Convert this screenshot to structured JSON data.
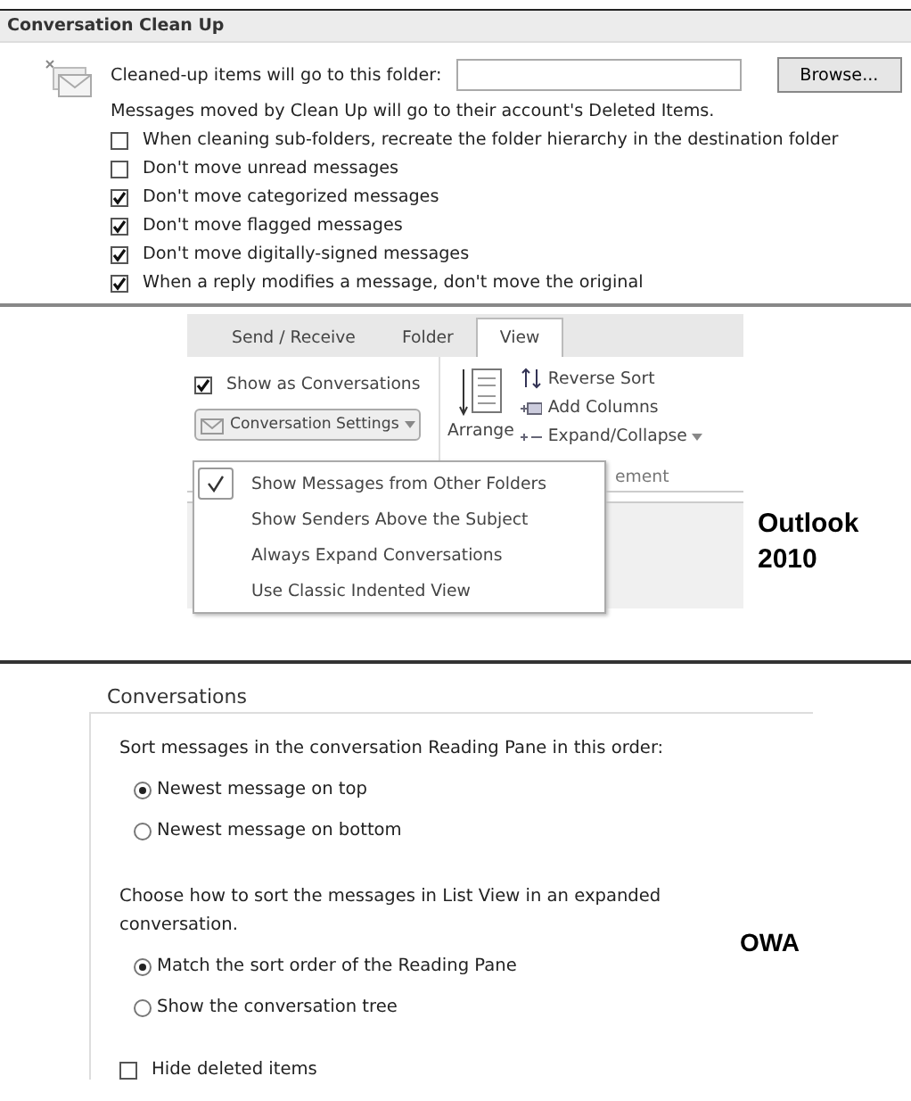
{
  "cleanup": {
    "title": "Conversation Clean Up",
    "folder_label": "Cleaned-up items will go to this folder:",
    "browse": "Browse...",
    "note": "Messages moved by Clean Up will go to their account's Deleted Items.",
    "options": [
      {
        "label": "When cleaning sub-folders, recreate the folder hierarchy in the destination folder",
        "checked": false
      },
      {
        "label": "Don't move unread messages",
        "checked": false
      },
      {
        "label": "Don't move categorized messages",
        "checked": true
      },
      {
        "label": "Don't move flagged messages",
        "checked": true
      },
      {
        "label": "Don't move digitally-signed messages",
        "checked": true
      },
      {
        "label": "When a reply modifies a message, don't move the original",
        "checked": true
      }
    ]
  },
  "ribbon": {
    "tabs": [
      {
        "label": "Send / Receive",
        "selected": false
      },
      {
        "label": "Folder",
        "selected": false
      },
      {
        "label": "View",
        "selected": true
      }
    ],
    "show_as_conversations": {
      "label": "Show as Conversations",
      "checked": true
    },
    "conversation_settings": "Conversation Settings",
    "arrange_by": "Arrange",
    "commands": [
      "Reverse Sort",
      "Add Columns",
      "Expand/Collapse"
    ],
    "group_label": "ement",
    "menu": [
      {
        "label": "Show Messages from Other Folders",
        "checked": true
      },
      {
        "label": "Show Senders Above the Subject",
        "checked": false
      },
      {
        "label": "Always Expand Conversations",
        "checked": false
      },
      {
        "label": "Use Classic Indented View",
        "checked": false
      }
    ]
  },
  "outlook_label": "Outlook 2010",
  "owa": {
    "title": "Conversations",
    "sections": [
      {
        "prompt": "Sort messages in the conversation Reading Pane in this order:",
        "options": [
          {
            "label": "Newest message on top",
            "selected": true
          },
          {
            "label": "Newest message on bottom",
            "selected": false
          }
        ]
      },
      {
        "prompt": "Choose how to sort the messages in List View in an expanded conversation.",
        "options": [
          {
            "label": "Match the sort order of the Reading Pane",
            "selected": true
          },
          {
            "label": "Show the conversation tree",
            "selected": false
          }
        ]
      }
    ],
    "hide_deleted": {
      "label": "Hide deleted items",
      "checked": false
    },
    "label": "OWA"
  }
}
